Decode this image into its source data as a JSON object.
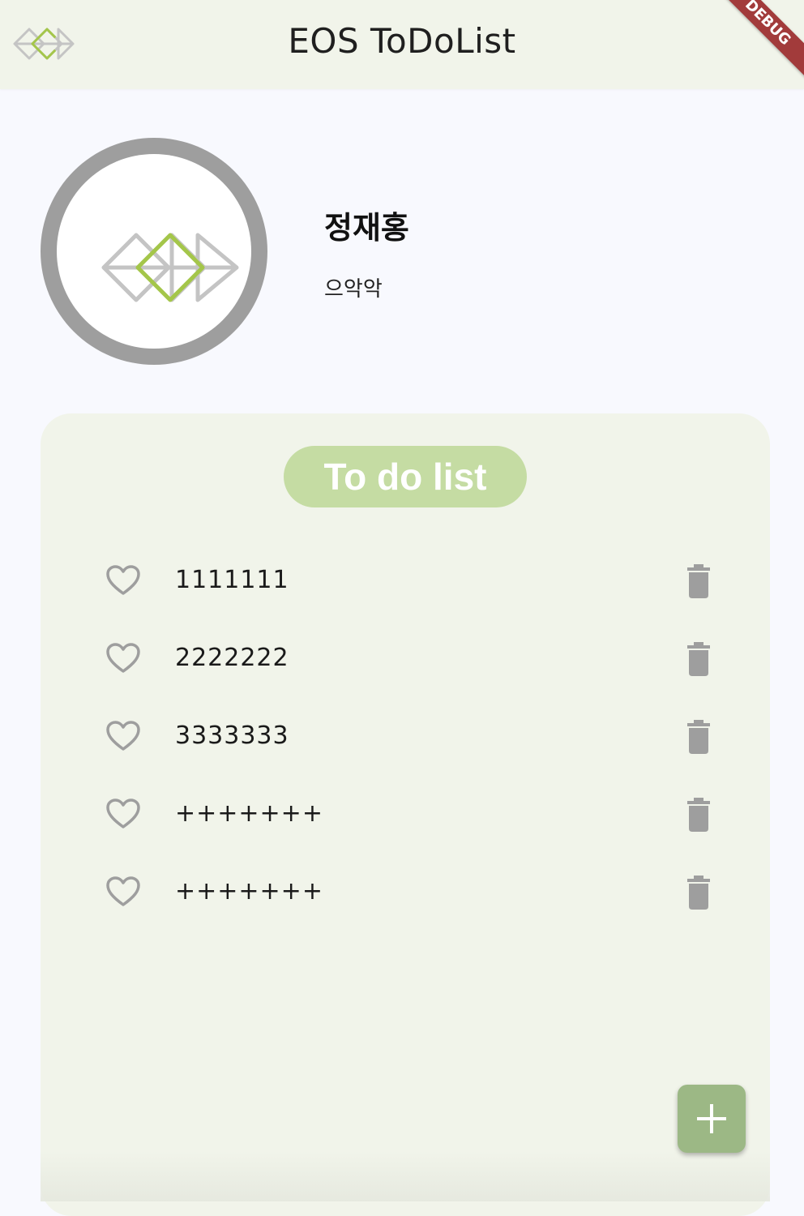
{
  "app_bar": {
    "title": "EOS ToDoList",
    "logo_icon": "eos-diamond-logo-icon",
    "debug_label": "DEBUG"
  },
  "profile": {
    "avatar_icon": "eos-diamond-logo-icon",
    "name": "정재홍",
    "status": "으악악"
  },
  "todo": {
    "header": "To do list",
    "items": [
      {
        "text": "1111111",
        "like_icon": "heart-outline-icon",
        "delete_icon": "trash-icon"
      },
      {
        "text": "2222222",
        "like_icon": "heart-outline-icon",
        "delete_icon": "trash-icon"
      },
      {
        "text": "3333333",
        "like_icon": "heart-outline-icon",
        "delete_icon": "trash-icon"
      },
      {
        "text": "+++++++",
        "like_icon": "heart-outline-icon",
        "delete_icon": "trash-icon"
      },
      {
        "text": "+++++++",
        "like_icon": "heart-outline-icon",
        "delete_icon": "trash-icon"
      }
    ]
  },
  "fab": {
    "icon": "plus-icon"
  },
  "colors": {
    "app_bar_bg": "#f1f4ea",
    "page_bg": "#f8f9fe",
    "panel_bg": "#f1f4ea",
    "header_pill": "#c5dca3",
    "fab_bg": "#9cb885",
    "avatar_ring": "#9e9e9e",
    "logo_green": "#a4c64a",
    "logo_gray": "#c4c4c4",
    "icon_gray": "#9e9e9e",
    "debug_red": "#a23b3b"
  }
}
